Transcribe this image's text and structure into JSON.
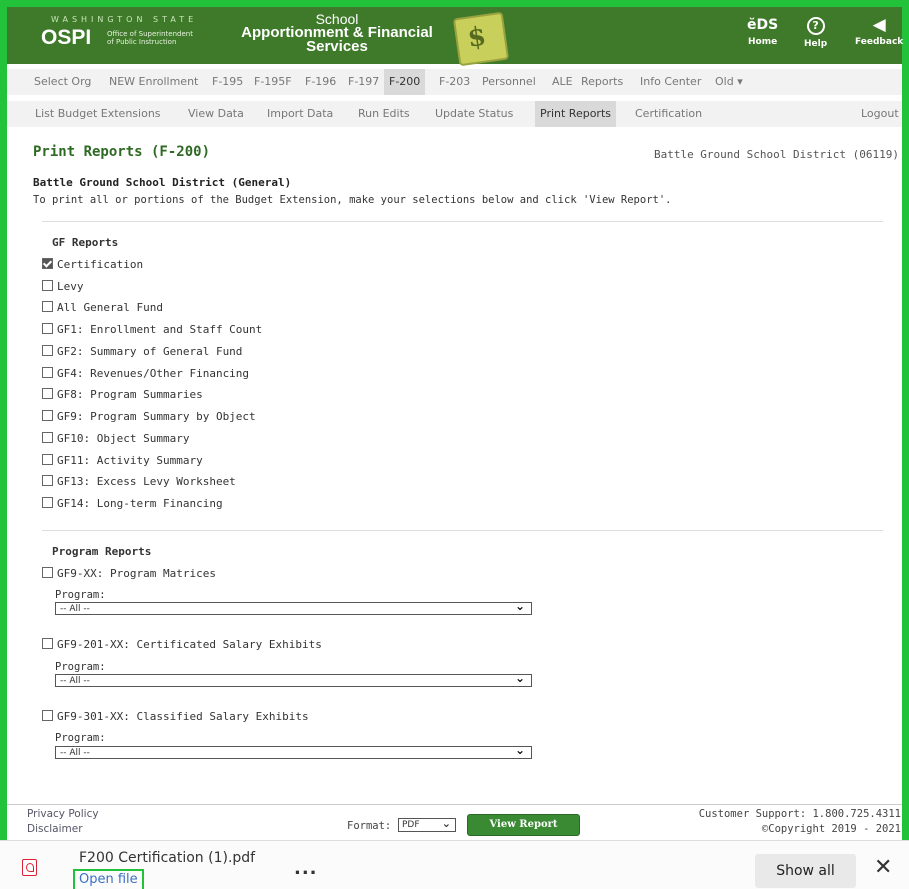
{
  "header": {
    "ospi_state": "WASHINGTON STATE",
    "ospi_logo": "OSPI",
    "ospi_subtitle": "Office of Superintendent of Public Instruction",
    "app_title_line1": "School",
    "app_title_line2": "Apportionment & Financial",
    "app_title_line3": "Services",
    "buttons": [
      {
        "label": "Home",
        "icon": "eds-home-icon",
        "glyph": "ĕDS"
      },
      {
        "label": "Help",
        "icon": "help-icon",
        "glyph": "?"
      },
      {
        "label": "Feedback",
        "icon": "megaphone-icon",
        "glyph": "◀"
      }
    ]
  },
  "nav1": [
    "Select Org",
    "NEW Enrollment",
    "F-195",
    "F-195F",
    "F-196",
    "F-197",
    "F-200",
    "F-203",
    "Personnel",
    "ALE",
    "Reports",
    "Info Center",
    "Old ▾"
  ],
  "nav1_active": "F-200",
  "nav2": [
    "List Budget Extensions",
    "View Data",
    "Import Data",
    "Run Edits",
    "Update Status",
    "Print Reports",
    "Certification"
  ],
  "nav2_active": "Print Reports",
  "nav2_logout": "Logout",
  "page": {
    "title": "Print Reports (F-200)",
    "district_right": "Battle Ground School District (06119)",
    "district_bold": "Battle Ground School District (General)",
    "instructions": "To print all or portions of the Budget Extension, make your selections below and click 'View Report'."
  },
  "gf_reports": {
    "heading": "GF Reports",
    "items": [
      {
        "label": "Certification",
        "checked": true
      },
      {
        "label": "Levy",
        "checked": false
      },
      {
        "label": "All General Fund",
        "checked": false
      },
      {
        "label": "GF1: Enrollment and Staff Count",
        "checked": false
      },
      {
        "label": "GF2: Summary of General Fund",
        "checked": false
      },
      {
        "label": "GF4: Revenues/Other Financing",
        "checked": false
      },
      {
        "label": "GF8: Program Summaries",
        "checked": false
      },
      {
        "label": "GF9: Program Summary by Object",
        "checked": false
      },
      {
        "label": "GF10: Object Summary",
        "checked": false
      },
      {
        "label": "GF11: Activity Summary",
        "checked": false
      },
      {
        "label": "GF13: Excess Levy Worksheet",
        "checked": false
      },
      {
        "label": "GF14: Long-term Financing",
        "checked": false
      }
    ]
  },
  "program_reports": {
    "heading": "Program Reports",
    "items": [
      {
        "label": "GF9-XX: Program Matrices",
        "checked": false,
        "program_label": "Program:",
        "program_value": "-- All --"
      },
      {
        "label": "GF9-201-XX: Certificated Salary Exhibits",
        "checked": false,
        "program_label": "Program:",
        "program_value": "-- All --"
      },
      {
        "label": "GF9-301-XX: Classified Salary Exhibits",
        "checked": false,
        "program_label": "Program:",
        "program_value": "-- All --"
      }
    ]
  },
  "footer": {
    "privacy": "Privacy Policy",
    "disclaimer": "Disclaimer",
    "format_label": "Format:",
    "format_value": "PDF",
    "view_report": "View Report",
    "support": "Customer Support: 1.800.725.4311",
    "copyright": "©Copyright 2019 - 2021"
  },
  "download_bar": {
    "file_name": "F200 Certification (1).pdf",
    "open_file": "Open file",
    "more": "...",
    "show_all": "Show all",
    "close": "✕"
  },
  "colors": {
    "header_green": "#3f7a2a",
    "title_green": "#2f6a24",
    "highlight_green": "#22c33a",
    "button_green": "#3a8a34"
  }
}
